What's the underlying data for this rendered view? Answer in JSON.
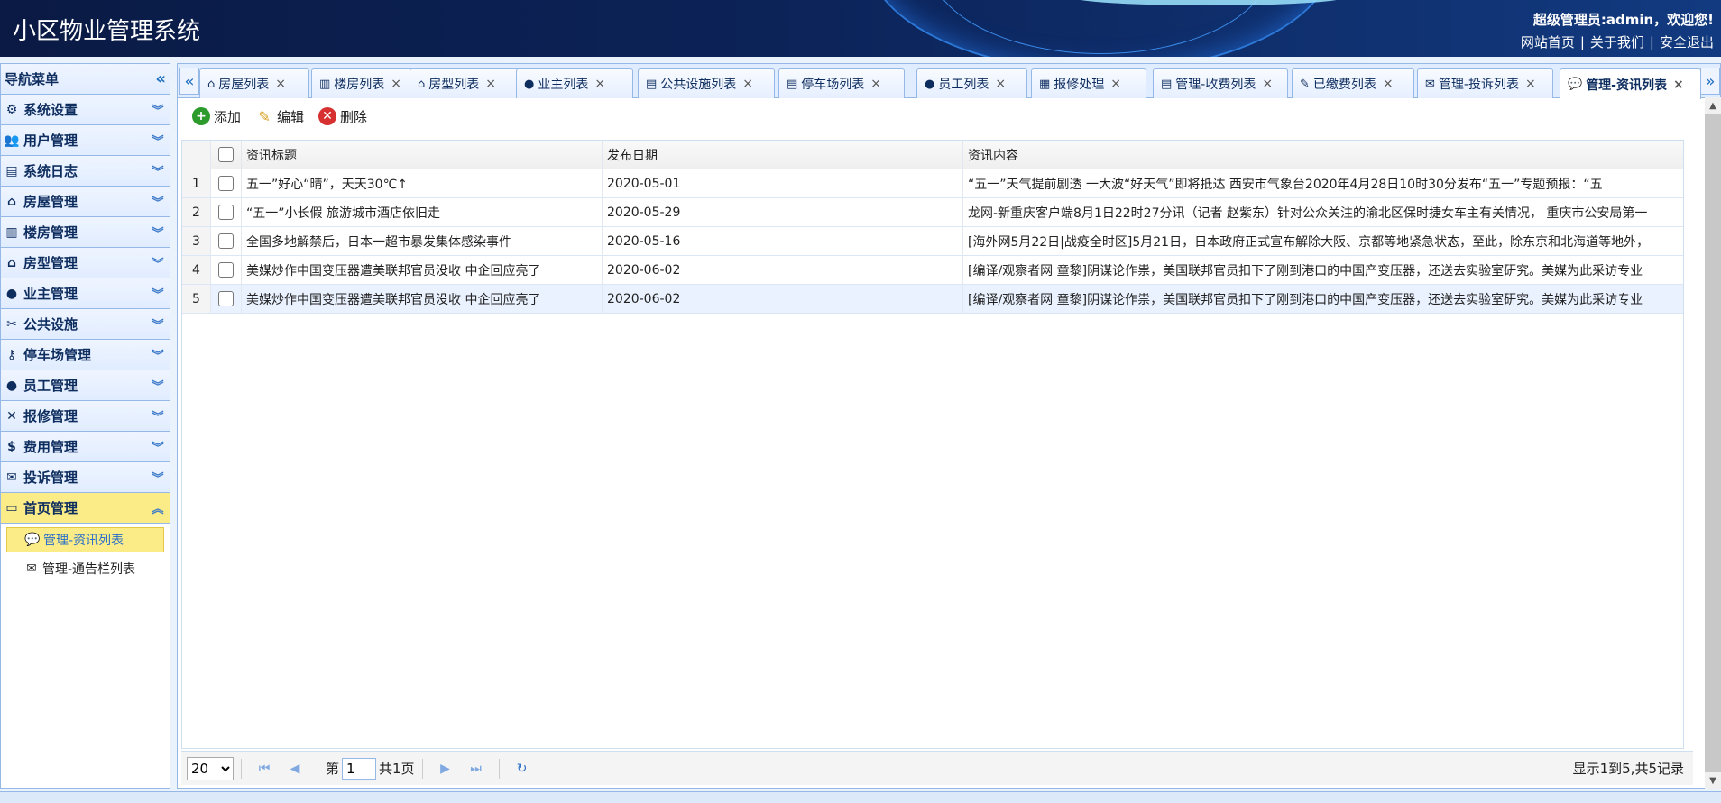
{
  "header": {
    "app_title": "小区物业管理系统",
    "welcome": "超级管理员:admin，欢迎您!",
    "links": [
      "网站首页",
      "关于我们",
      "安全退出"
    ],
    "separator": "|"
  },
  "sidebar": {
    "title": "导航菜单",
    "collapse_glyph": "«",
    "items": [
      {
        "label": "系统设置",
        "icon": "gear-icon",
        "glyph": "⚙"
      },
      {
        "label": "用户管理",
        "icon": "users-icon",
        "glyph": "👥"
      },
      {
        "label": "系统日志",
        "icon": "log-icon",
        "glyph": "▤"
      },
      {
        "label": "房屋管理",
        "icon": "house-icon",
        "glyph": "⌂"
      },
      {
        "label": "楼房管理",
        "icon": "building-icon",
        "glyph": "▥"
      },
      {
        "label": "房型管理",
        "icon": "house-type-icon",
        "glyph": "⌂"
      },
      {
        "label": "业主管理",
        "icon": "owner-icon",
        "glyph": "●"
      },
      {
        "label": "公共设施",
        "icon": "tools-icon",
        "glyph": "✂"
      },
      {
        "label": "停车场管理",
        "icon": "key-icon",
        "glyph": "⚷"
      },
      {
        "label": "员工管理",
        "icon": "staff-icon",
        "glyph": "●"
      },
      {
        "label": "报修管理",
        "icon": "repair-icon",
        "glyph": "✕"
      },
      {
        "label": "费用管理",
        "icon": "money-icon",
        "glyph": "$"
      },
      {
        "label": "投诉管理",
        "icon": "complaint-icon",
        "glyph": "✉"
      },
      {
        "label": "首页管理",
        "icon": "home-page-icon",
        "glyph": "▭"
      }
    ],
    "sub_items": [
      {
        "label": "管理-资讯列表",
        "icon": "chat-icon",
        "glyph": "💬"
      },
      {
        "label": "管理-通告栏列表",
        "icon": "notice-icon",
        "glyph": "✉"
      }
    ]
  },
  "tabs": {
    "scroll_left": "«",
    "scroll_right": "»",
    "close_glyph": "×",
    "items": [
      {
        "label": "房屋列表",
        "glyph": "⌂"
      },
      {
        "label": "楼房列表",
        "glyph": "▥"
      },
      {
        "label": "房型列表",
        "glyph": "⌂"
      },
      {
        "label": "业主列表",
        "glyph": "●"
      },
      {
        "label": "公共设施列表",
        "glyph": "▤"
      },
      {
        "label": "停车场列表",
        "glyph": "▤"
      },
      {
        "label": "员工列表",
        "glyph": "●"
      },
      {
        "label": "报修处理",
        "glyph": "▦"
      },
      {
        "label": "管理-收费列表",
        "glyph": "▤"
      },
      {
        "label": "已缴费列表",
        "glyph": "✎"
      },
      {
        "label": "管理-投诉列表",
        "glyph": "✉"
      },
      {
        "label": "管理-资讯列表",
        "glyph": "💬"
      }
    ]
  },
  "toolbar": {
    "add_label": "添加",
    "edit_label": "编辑",
    "delete_label": "删除"
  },
  "grid": {
    "columns": [
      "资讯标题",
      "发布日期",
      "资讯内容"
    ],
    "rows": [
      {
        "num": "1",
        "title": "五一”好心“晴”，天天30℃↑",
        "date": "2020-05-01",
        "content": "“五一”天气提前剧透 一大波“好天气”即将抵达 西安市气象台2020年4月28日10时30分发布“五一”专题预报：“五"
      },
      {
        "num": "2",
        "title": "“五一”小长假 旅游城市酒店依旧走",
        "date": "2020-05-29",
        "content": "龙网-新重庆客户端8月1日22时27分讯（记者 赵紫东）针对公众关注的渝北区保时捷女车主有关情况， 重庆市公安局第一"
      },
      {
        "num": "3",
        "title": "全国多地解禁后，日本一超市暴发集体感染事件",
        "date": "2020-05-16",
        "content": "[海外网5月22日|战疫全时区]5月21日，日本政府正式宣布解除大阪、京都等地紧急状态，至此，除东京和北海道等地外，"
      },
      {
        "num": "4",
        "title": "美媒炒作中国变压器遭美联邦官员没收 中企回应亮了",
        "date": "2020-06-02",
        "content": "[编译/观察者网 童黎]阴谋论作祟，美国联邦官员扣下了刚到港口的中国产变压器，还送去实验室研究。美媒为此采访专业"
      },
      {
        "num": "5",
        "title": "美媒炒作中国变压器遭美联邦官员没收 中企回应亮了",
        "date": "2020-06-02",
        "content": "[编译/观察者网 童黎]阴谋论作祟，美国联邦官员扣下了刚到港口的中国产变压器，还送去实验室研究。美媒为此采访专业"
      }
    ]
  },
  "pager": {
    "page_size": "20",
    "page_size_options": [
      "20"
    ],
    "page_prefix": "第",
    "current_page": "1",
    "total_pages": "共1页",
    "info": "显示1到5,共5记录"
  }
}
